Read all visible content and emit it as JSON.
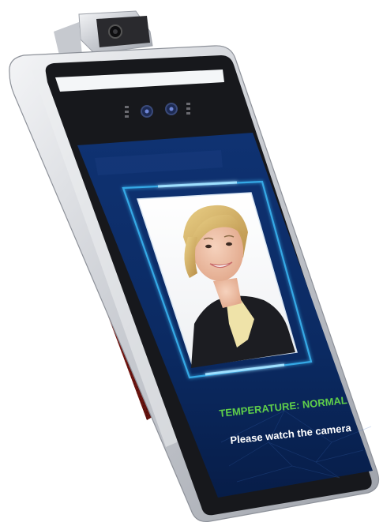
{
  "device": {
    "status_text": "TEMPERATURE: NORMAL",
    "prompt_text": "Please watch the camera"
  },
  "colors": {
    "screen_bg": "#0d2c63",
    "screen_bg_dark": "#071d48",
    "status_green": "#5fcf4a",
    "prompt_white": "#ffffff",
    "frame_glow": "#35a9e6",
    "bezel": "#1b1b1f",
    "casing_silver": "#d6d8dc",
    "side_grille": "#7a1612"
  },
  "icons": {
    "thermal_camera": "thermal-camera-icon",
    "dual_lens": "dual-camera-icon",
    "person": "person-photo-icon"
  }
}
